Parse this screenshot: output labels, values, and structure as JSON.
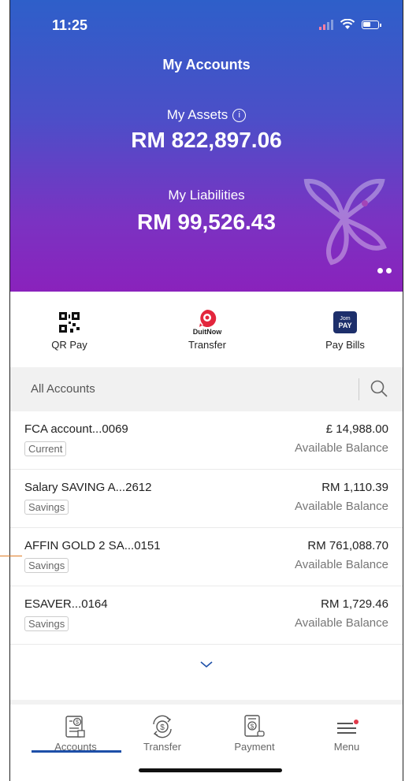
{
  "status": {
    "time": "11:25"
  },
  "header": {
    "title": "My Accounts"
  },
  "summary": {
    "assets_label": "My Assets",
    "assets_value": "RM 822,897.06",
    "liabilities_label": "My Liabilities",
    "liabilities_value": "RM 99,526.43"
  },
  "quick_actions": [
    {
      "label": "QR Pay",
      "icon": "qr-code-icon"
    },
    {
      "label": "Transfer",
      "icon": "duitnow-icon",
      "brand": "DuitNow"
    },
    {
      "label": "Pay Bills",
      "icon": "jompay-icon",
      "brand": "Jom PAY"
    }
  ],
  "accounts_section": {
    "label": "All Accounts"
  },
  "accounts": [
    {
      "name": "FCA account...0069",
      "type": "Current",
      "amount": "£ 14,988.00",
      "sub": "Available Balance"
    },
    {
      "name": "Salary SAVING A...2612",
      "type": "Savings",
      "amount": "RM 1,110.39",
      "sub": "Available Balance"
    },
    {
      "name": "AFFIN GOLD 2 SA...0151",
      "type": "Savings",
      "amount": "RM 761,088.70",
      "sub": "Available Balance"
    },
    {
      "name": "ESAVER...0164",
      "type": "Savings",
      "amount": "RM 1,729.46",
      "sub": "Available Balance"
    }
  ],
  "nav": [
    {
      "label": "Accounts",
      "icon": "accounts-icon",
      "active": true
    },
    {
      "label": "Transfer",
      "icon": "transfer-icon"
    },
    {
      "label": "Payment",
      "icon": "payment-icon"
    },
    {
      "label": "Menu",
      "icon": "menu-icon"
    }
  ],
  "colors": {
    "brand_blue": "#1d4fa8",
    "gradient_top": "#2e5fc9",
    "gradient_bottom": "#8a22bc",
    "duitnow_red": "#e3263d",
    "notification_dot": "#e0394a"
  }
}
